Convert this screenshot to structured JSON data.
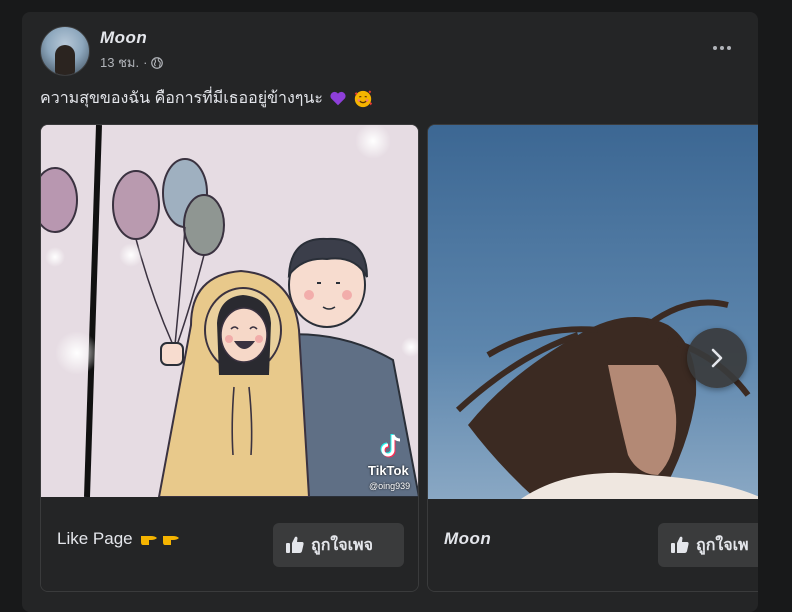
{
  "post": {
    "author_name": "Moon",
    "timestamp": "13 ชม.",
    "separator": "·",
    "audience_icon": "globe-icon",
    "more_icon": "more-horizontal-icon",
    "caption_text": "ความสุขของฉัน คือการที่มีเธออยู่ข้างๆนะ",
    "caption_emojis": [
      "purple-heart",
      "smiling-face-with-hearts"
    ]
  },
  "carousel": {
    "cards": [
      {
        "title": "Like Page",
        "title_icons": [
          "pointing-right-icon",
          "pointing-right-icon"
        ],
        "button_label": "ถูกใจเพจ",
        "image": {
          "description_icon": "couple-with-balloons-illustration",
          "watermark_brand": "TikTok",
          "watermark_handle": "@oing939"
        }
      },
      {
        "title": "Moon",
        "button_label": "ถูกใจเพ",
        "image": {
          "description_icon": "girl-wind-blown-hair-photo"
        }
      }
    ],
    "next_icon": "chevron-right-icon"
  },
  "colors": {
    "background": "#18191a",
    "card": "#242526",
    "button": "#3a3b3c",
    "primary_text": "#e4e6eb",
    "secondary_text": "#b0b3b8"
  }
}
